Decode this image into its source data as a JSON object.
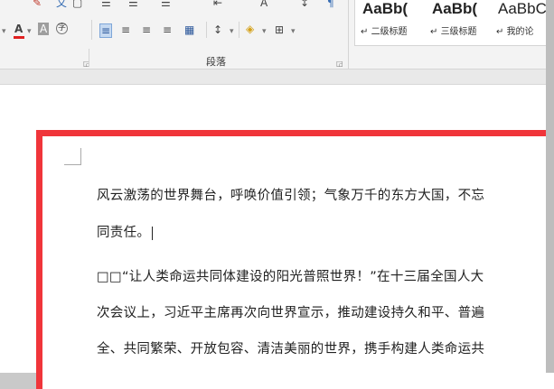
{
  "ribbon": {
    "paragraph_group_label": "段落",
    "styles": [
      {
        "preview": "AaBb(",
        "name": "二级标题"
      },
      {
        "preview": "AaBb(",
        "name": "三级标题"
      },
      {
        "preview": "AaBbC",
        "name": "我的论"
      }
    ],
    "icons": {
      "font_color": "A",
      "char_shading": "A",
      "enclose_char": "字",
      "font_size_up": "A"
    }
  },
  "document": {
    "lines": [
      "风云激荡的世界舞台，呼唤价值引领；气象万千的东方大国，不忘",
      "同责任。",
      "□□“让人类命运共同体建设的阳光普照世界！”在十三届全国人大",
      "次会议上，习近平主席再次向世界宣示，推动建设持久和平、普遍",
      "全、共同繁荣、开放包容、清洁美丽的世界，携手构建人类命运共"
    ]
  },
  "colors": {
    "page_border": "#f0353a",
    "accent": "#2b579a"
  }
}
